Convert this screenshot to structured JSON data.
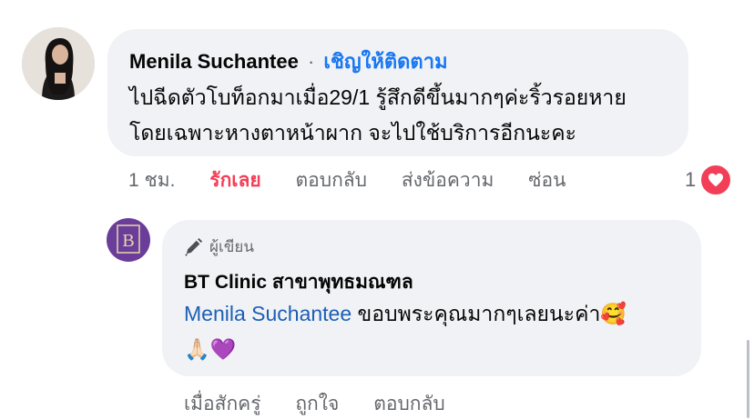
{
  "comment": {
    "author": "Menila Suchantee",
    "separator": "·",
    "follow_label": "เชิญให้ติดตาม",
    "text_line1": "ไปฉีดตัวโบท็อกมาเมื่อ29/1 รู้สึกดีขึ้นมากๆค่ะริ้วรอยหาย",
    "text_line2": "โดยเฉพาะหางตาหน้าผาก จะไปใช้บริการอีกนะคะ",
    "time": "1 ชม.",
    "love_label": "รักเลย",
    "reply_label": "ตอบกลับ",
    "message_label": "ส่งข้อความ",
    "hide_label": "ซ่อน",
    "reaction_count": "1",
    "reaction_icon": "heart-icon",
    "reaction_color": "#f33e58"
  },
  "reply": {
    "role_label": "ผู้เขียน",
    "role_icon": "pencil-icon",
    "author": "BT Clinic สาขาพุทธมณฑล",
    "mention": "Menila Suchantee",
    "text": " ขอบพระคุณมากๆเลยนะค่า",
    "emoji_1": "🥰",
    "emoji_2": "🙏🏻",
    "emoji_3": "💜",
    "time": "เมื่อสักครู่",
    "like_label": "ถูกใจ",
    "reply_label": "ตอบกลับ",
    "avatar_color": "#6a3d9a"
  },
  "colors": {
    "bubble": "#f0f2f5",
    "link": "#1877f2",
    "muted": "#65676b",
    "love": "#f33e58"
  }
}
